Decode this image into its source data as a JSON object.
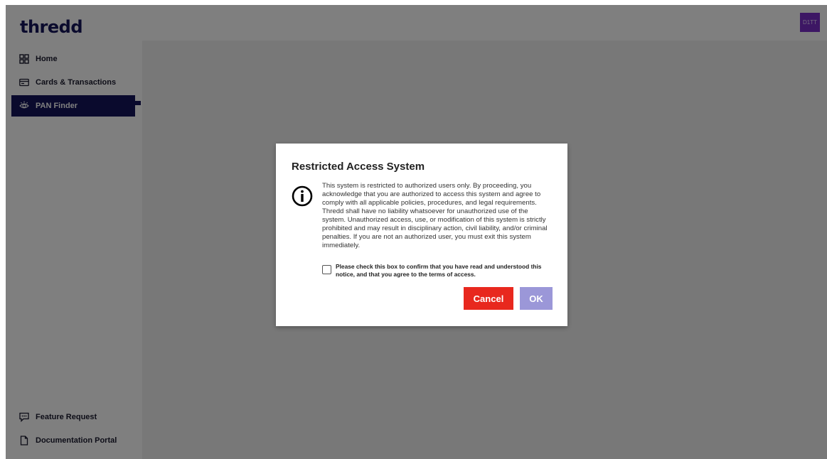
{
  "app": {
    "logo": "thredd",
    "avatar_text": "D1TT"
  },
  "sidebar": {
    "items": [
      {
        "label": "Home",
        "icon": "grid-icon"
      },
      {
        "label": "Cards & Transactions",
        "icon": "card-icon"
      },
      {
        "label": "PAN Finder",
        "icon": "eye-icon",
        "active": true
      }
    ],
    "bottom_items": [
      {
        "label": "Feature Request",
        "icon": "chat-icon"
      },
      {
        "label": "Documentation Portal",
        "icon": "document-icon"
      }
    ]
  },
  "modal": {
    "title": "Restricted Access System",
    "body": "This system is restricted to authorized users only. By proceeding, you acknowledge that you are authorized to access this system and agree to comply with all applicable policies, procedures, and legal requirements. Thredd shall have no liability whatsoever for unauthorized use of the system. Unauthorized access, use, or modification of this system is strictly prohibited and may result in disciplinary action, civil liability, and/or criminal penalties. If you are not an authorized user, you must exit this system immediately.",
    "consent_label": "Please check this box to confirm that you have read and understood this notice, and that you agree to the terms of access.",
    "consent_checked": false,
    "cancel_label": "Cancel",
    "ok_label": "OK"
  },
  "colors": {
    "brand": "#14155a",
    "avatar": "#7b2fc9",
    "cancel": "#e8281e",
    "ok_disabled": "#9b97d8"
  }
}
